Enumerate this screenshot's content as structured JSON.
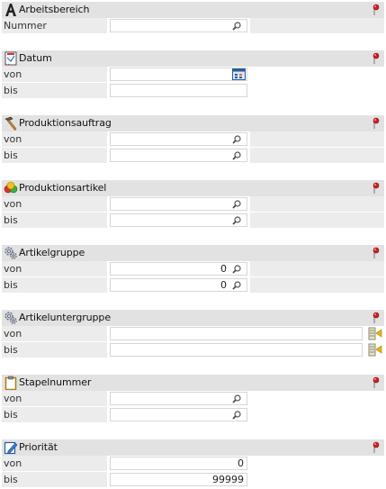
{
  "sections": {
    "arbeitsbereich": {
      "title": "Arbeitsbereich",
      "nummer_label": "Nummer",
      "nummer_value": ""
    },
    "datum": {
      "title": "Datum",
      "von_label": "von",
      "bis_label": "bis"
    },
    "produktionsauftrag": {
      "title": "Produktionsauftrag",
      "von_label": "von",
      "bis_label": "bis"
    },
    "produktionsartikel": {
      "title": "Produktionsartikel",
      "von_label": "von",
      "bis_label": "bis"
    },
    "artikelgruppe": {
      "title": "Artikelgruppe",
      "von_label": "von",
      "bis_label": "bis",
      "von_value": "0",
      "bis_value": "0"
    },
    "artikeluntergruppe": {
      "title": "Artikeluntergruppe",
      "von_label": "von",
      "bis_label": "bis"
    },
    "stapelnummer": {
      "title": "Stapelnummer",
      "von_label": "von",
      "bis_label": "bis"
    },
    "prioritaet": {
      "title": "Priorität",
      "von_label": "von",
      "bis_label": "bis",
      "von_value": "0",
      "bis_value": "99999"
    }
  },
  "colors": {
    "header_bg": "#e2e2e2",
    "row_bg": "#ececec",
    "pin_red": "#cc2222"
  }
}
